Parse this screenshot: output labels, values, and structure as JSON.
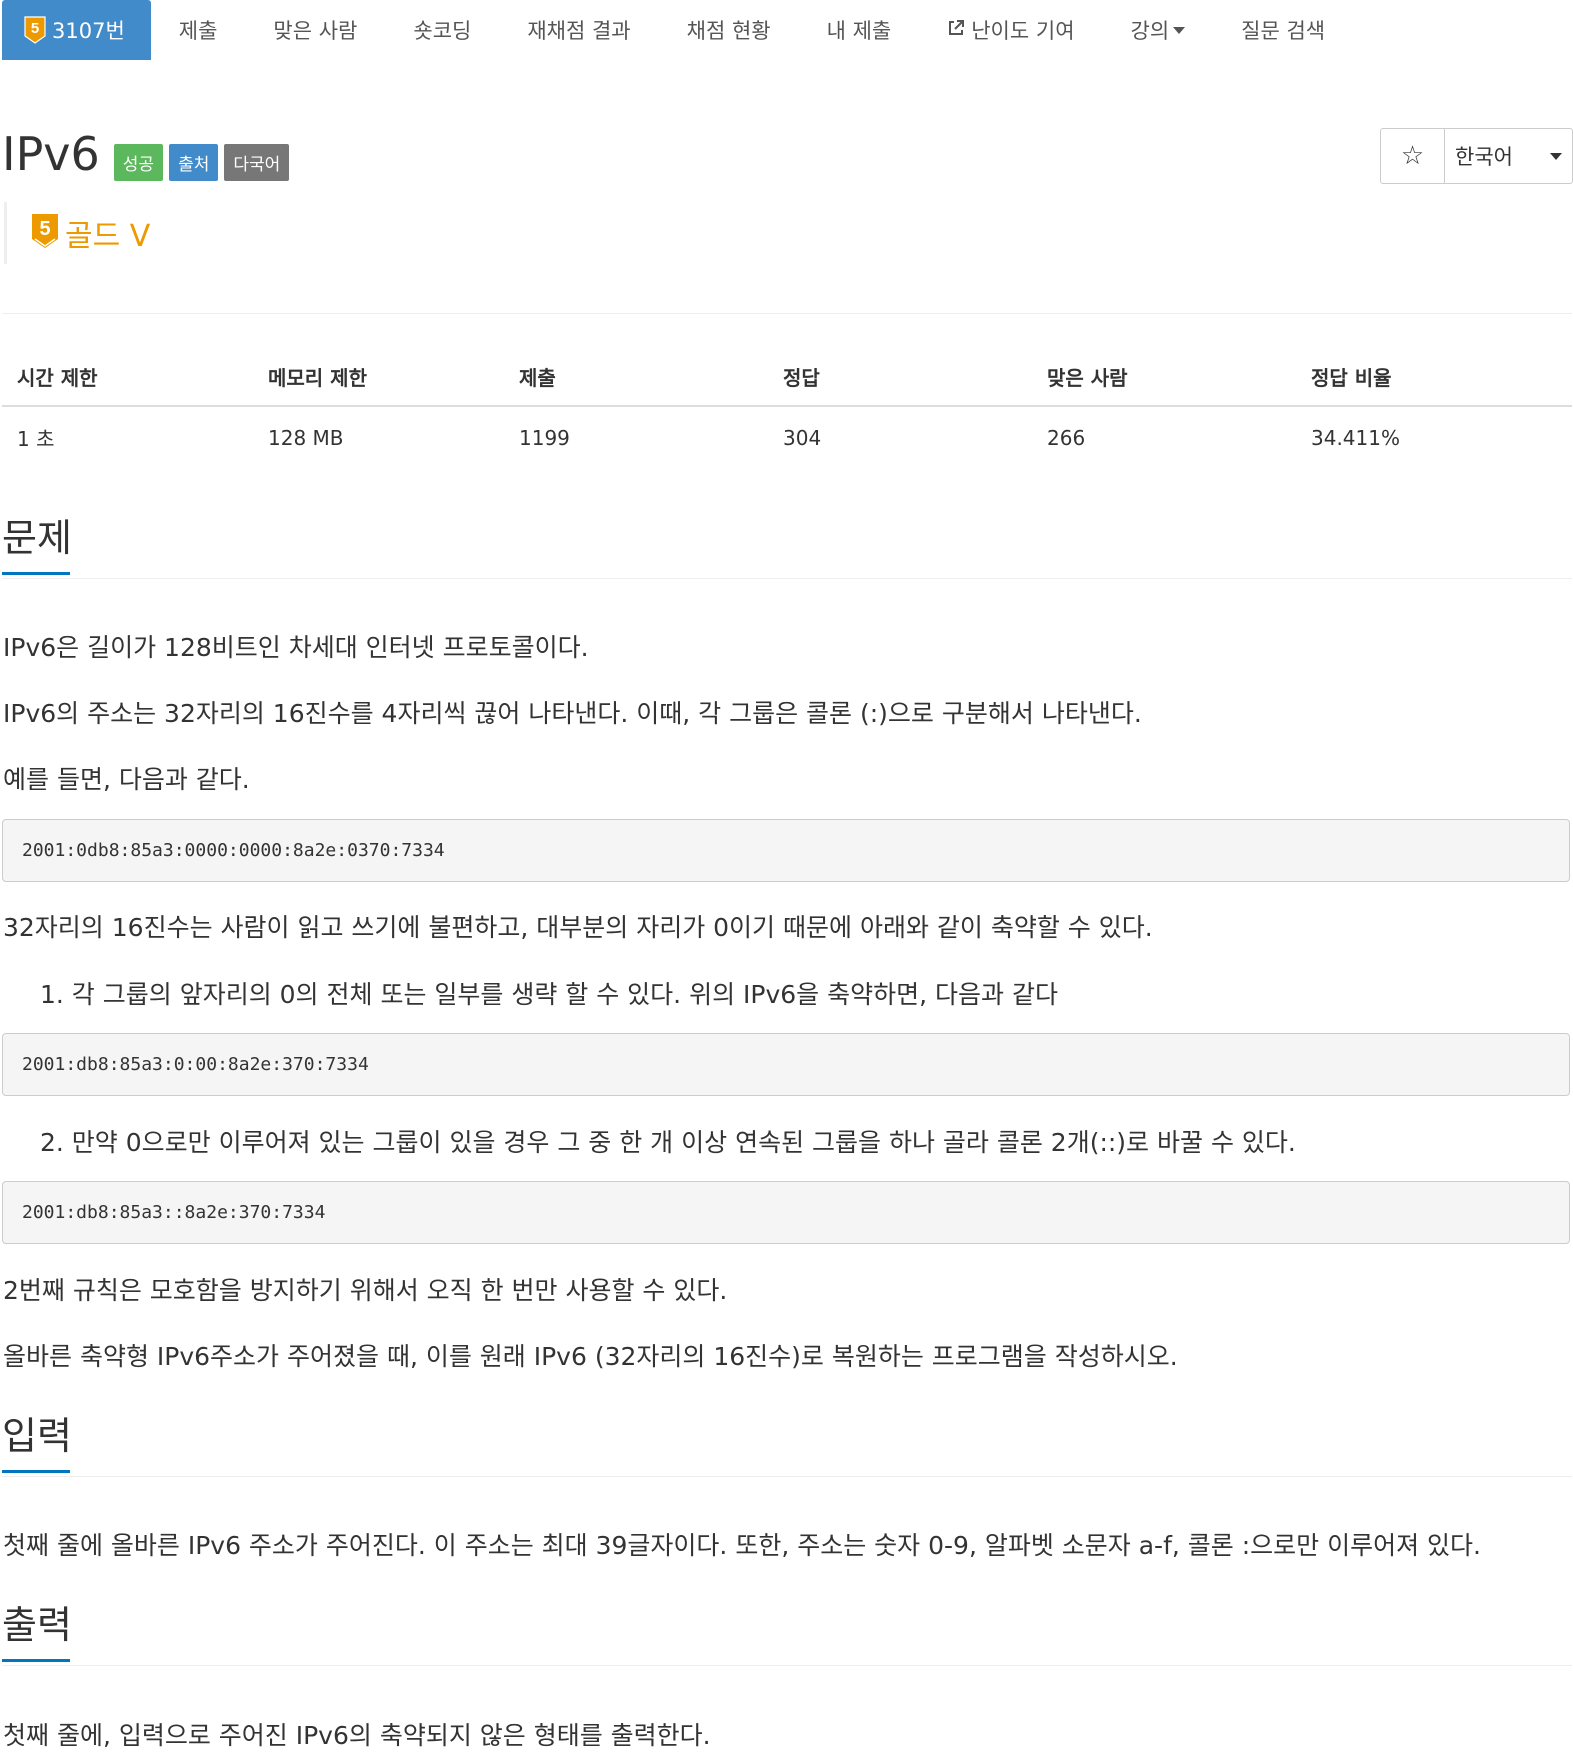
{
  "nav": {
    "tabs": [
      {
        "label": "3107번",
        "active": true
      },
      {
        "label": "제출"
      },
      {
        "label": "맞은 사람"
      },
      {
        "label": "숏코딩"
      },
      {
        "label": "재채점 결과"
      },
      {
        "label": "채점 현황"
      },
      {
        "label": "내 제출"
      },
      {
        "label": "난이도 기여"
      },
      {
        "label": "강의"
      },
      {
        "label": "질문 검색"
      }
    ],
    "tier_badge_number": "5"
  },
  "problem": {
    "title": "IPv6",
    "labels": [
      "성공",
      "출처",
      "다국어"
    ],
    "tier": {
      "badge_number": "5",
      "name": "골드 V"
    },
    "star_icon": "☆",
    "language": "한국어"
  },
  "stats": {
    "headers": [
      "시간 제한",
      "메모리 제한",
      "제출",
      "정답",
      "맞은 사람",
      "정답 비율"
    ],
    "values": [
      "1 초",
      "128 MB",
      "1199",
      "304",
      "266",
      "34.411%"
    ]
  },
  "sections": {
    "description": {
      "title": "문제",
      "p1": "IPv6은 길이가 128비트인 차세대 인터넷 프로토콜이다.",
      "p2": "IPv6의 주소는 32자리의 16진수를 4자리씩 끊어 나타낸다. 이때, 각 그룹은 콜론 (:)으로 구분해서 나타낸다.",
      "p3": "예를 들면, 다음과 같다.",
      "code1": "2001:0db8:85a3:0000:0000:8a2e:0370:7334",
      "p4": "32자리의 16진수는 사람이 읽고 쓰기에 불편하고, 대부분의 자리가 0이기 때문에 아래와 같이 축약할 수 있다.",
      "rule1": "1. 각 그룹의 앞자리의 0의 전체 또는 일부를 생략 할 수 있다. 위의 IPv6을 축약하면, 다음과 같다",
      "code2": "2001:db8:85a3:0:00:8a2e:370:7334",
      "rule2": "2. 만약 0으로만 이루어져 있는 그룹이 있을 경우 그 중 한 개 이상 연속된 그룹을 하나 골라 콜론 2개(::)로 바꿀 수 있다.",
      "code3": "2001:db8:85a3::8a2e:370:7334",
      "p5": "2번째 규칙은 모호함을 방지하기 위해서 오직 한 번만 사용할 수 있다.",
      "p6": "올바른 축약형 IPv6주소가 주어졌을 때, 이를 원래 IPv6 (32자리의 16진수)로 복원하는 프로그램을 작성하시오."
    },
    "input": {
      "title": "입력",
      "text": "첫째 줄에 올바른 IPv6 주소가 주어진다. 이 주소는 최대 39글자이다. 또한, 주소는 숫자 0-9, 알파벳 소문자 a-f, 콜론 :으로만 이루어져 있다."
    },
    "output": {
      "title": "출력",
      "text": "첫째 줄에, 입력으로 주어진 IPv6의 축약되지 않은 형태를 출력한다."
    }
  },
  "colors": {
    "primary": "#428bca",
    "success": "#5cb85c",
    "default": "#777777",
    "gold": "#ec9a00",
    "section_underline": "#0076c0"
  }
}
